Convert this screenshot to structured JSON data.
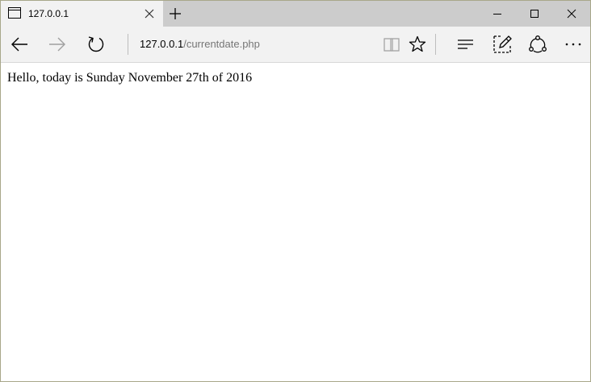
{
  "tab": {
    "title": "127.0.0.1",
    "icons": {
      "favicon": "page-icon",
      "close": "close-icon",
      "new_tab": "plus-icon"
    }
  },
  "window_controls": {
    "icons": [
      "minimize-icon",
      "maximize-icon",
      "close-icon"
    ]
  },
  "navbar": {
    "address": {
      "host": "127.0.0.1",
      "path": "/currentdate.php"
    },
    "icons": [
      "back-arrow-icon",
      "forward-arrow-icon",
      "refresh-icon",
      "reading-view-icon",
      "star-icon",
      "hub-icon",
      "web-note-icon",
      "share-icon",
      "more-icon"
    ]
  },
  "content": {
    "text": "Hello, today is Sunday November 27th of 2016"
  },
  "colors": {
    "titlebar_bg": "#cccccc",
    "tab_bg": "#f2f2f2",
    "disabled_icon": "#a0a0a0",
    "url_path": "#767676"
  }
}
